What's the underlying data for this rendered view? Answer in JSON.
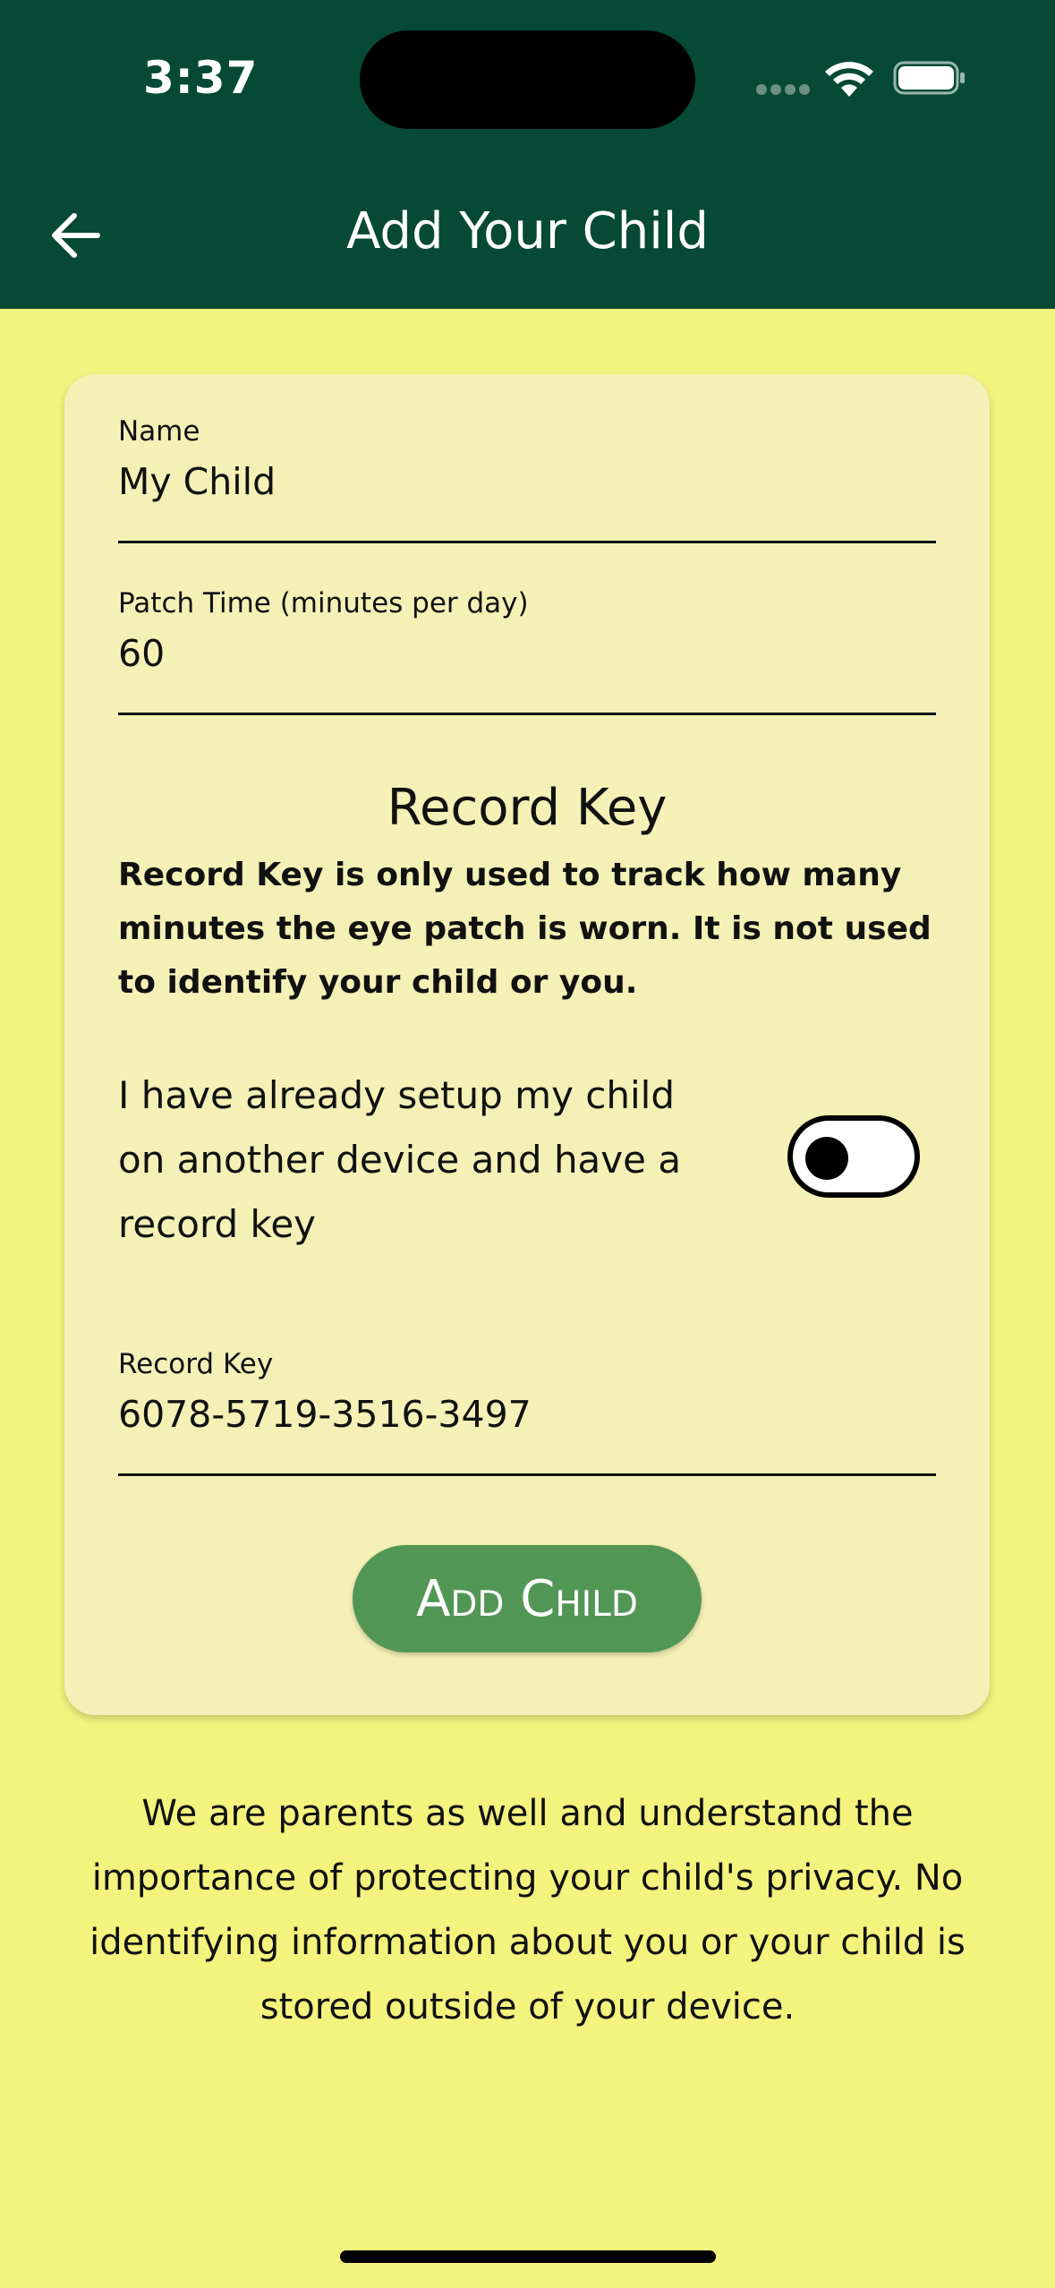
{
  "status_bar": {
    "time": "3:37"
  },
  "header": {
    "title": "Add Your Child",
    "back_icon": "arrow-left-icon",
    "background": "#064a36"
  },
  "form": {
    "name": {
      "label": "Name",
      "value": "My Child"
    },
    "patch_time": {
      "label": "Patch Time (minutes per day)",
      "value": "60"
    },
    "record_key_section": {
      "title": "Record Key",
      "description": "Record Key is only used to track how many minutes the eye patch is worn. It is not used to identify your child or you."
    },
    "existing_toggle": {
      "label": "I have already setup my child on another device and have a record key",
      "checked": false
    },
    "record_key": {
      "label": "Record Key",
      "value": "6078-5719-3516-3497"
    },
    "submit_label": "Add Child"
  },
  "privacy_note": "We are parents as well and understand the importance of protecting your child's privacy. No identifying information about you or your child is stored outside of your device.",
  "colors": {
    "page_background": "#f3f37e",
    "card_background": "#f5f0b6",
    "button": "#529656"
  }
}
